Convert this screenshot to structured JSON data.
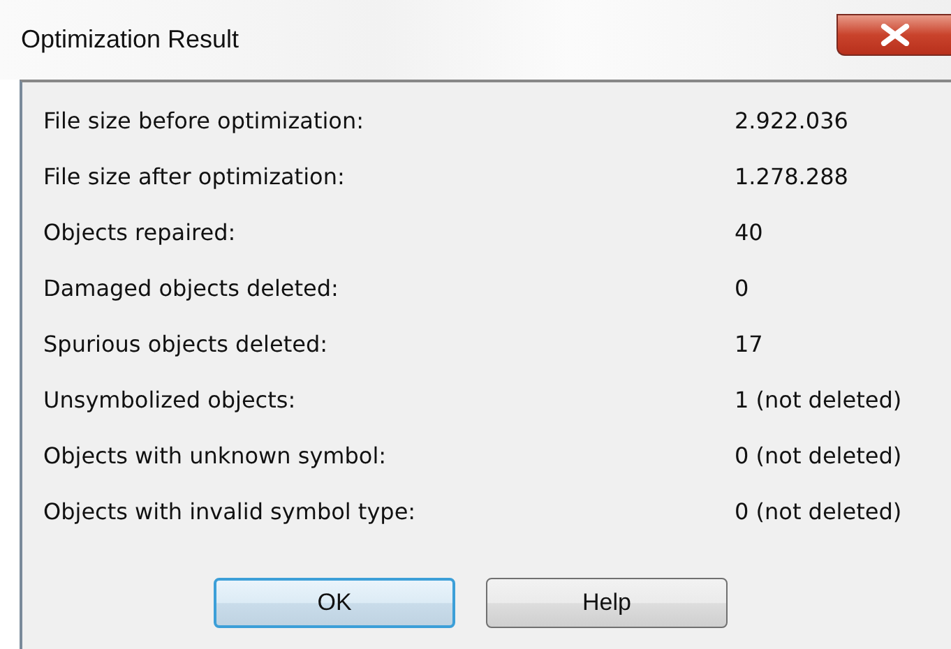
{
  "window": {
    "title": "Optimization Result"
  },
  "rows": [
    {
      "label": "File size before optimization:",
      "value": "2.922.036"
    },
    {
      "label": "File size after optimization:",
      "value": "1.278.288"
    },
    {
      "label": "Objects repaired:",
      "value": "40"
    },
    {
      "label": "Damaged objects deleted:",
      "value": "0"
    },
    {
      "label": "Spurious objects deleted:",
      "value": "17"
    },
    {
      "label": "Unsymbolized objects:",
      "value": "1 (not deleted)"
    },
    {
      "label": "Objects with unknown symbol:",
      "value": "0 (not deleted)"
    },
    {
      "label": "Objects with invalid symbol type:",
      "value": "0 (not deleted)"
    }
  ],
  "buttons": [
    {
      "label": "OK",
      "default": true
    },
    {
      "label": "Help",
      "default": false
    }
  ]
}
